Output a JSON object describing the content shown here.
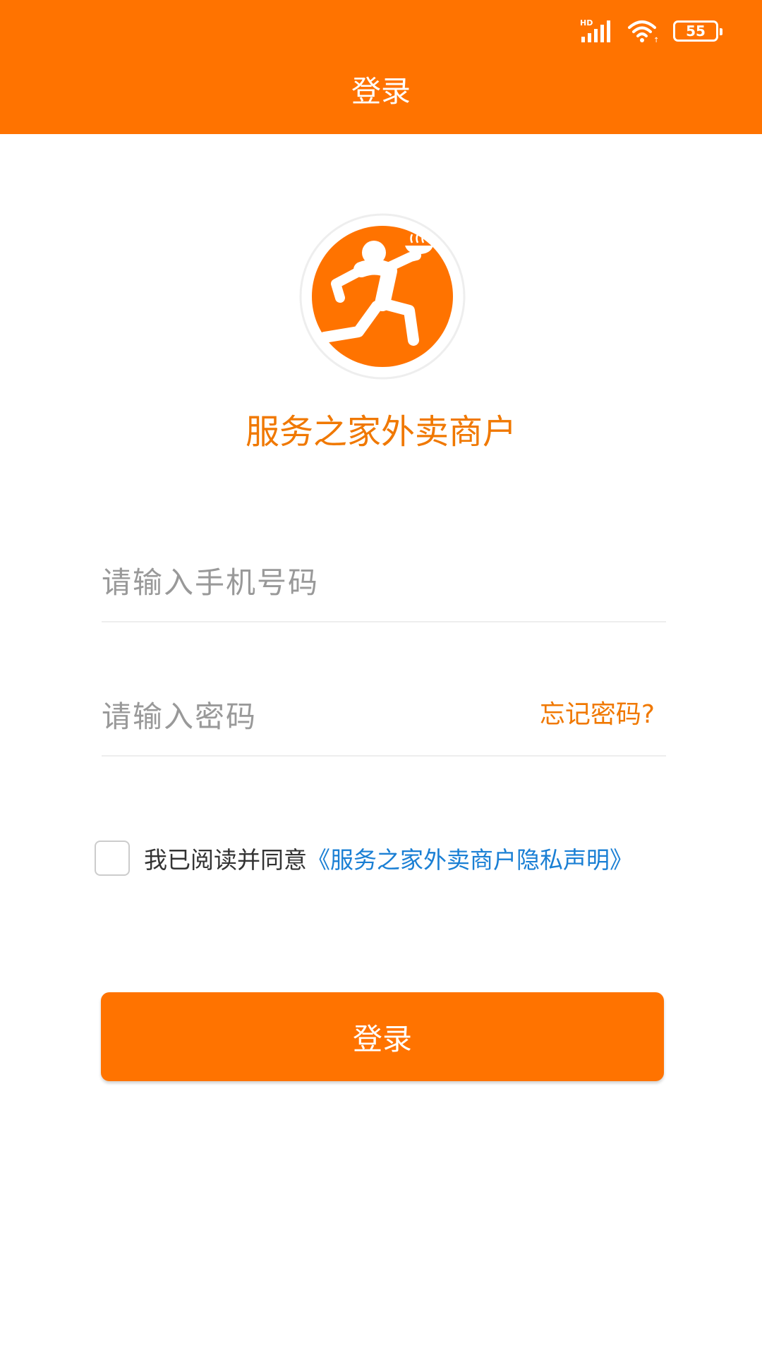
{
  "colors": {
    "brand_orange": "#FF7300",
    "brand_text_orange": "#F07800",
    "link_blue": "#1A7FD4",
    "placeholder_gray": "#999999"
  },
  "status_bar": {
    "network_label": "HD",
    "icons": [
      "signal-icon",
      "wifi-icon",
      "battery-icon"
    ],
    "battery_level": "55"
  },
  "header": {
    "title": "登录"
  },
  "brand": {
    "logo_icon": "running-delivery-person-logo",
    "name": "服务之家外卖商户"
  },
  "form": {
    "phone_placeholder": "请输入手机号码",
    "phone_value": "",
    "password_placeholder": "请输入密码",
    "password_value": "",
    "forgot_password": "忘记密码?"
  },
  "agreement": {
    "checked": false,
    "text": "我已阅读并同意",
    "policy_link": "《服务之家外卖商户隐私声明》"
  },
  "login_button": {
    "label": "登录"
  }
}
